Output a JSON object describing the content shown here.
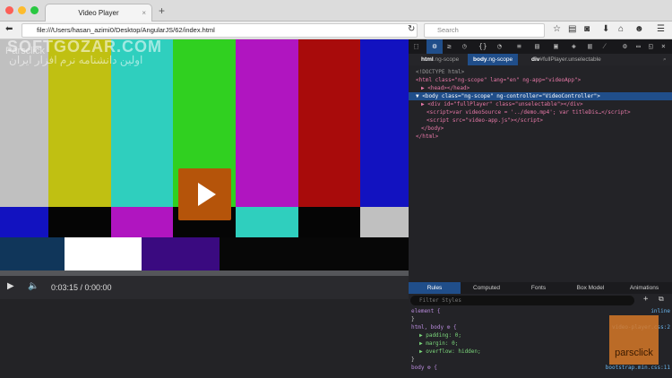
{
  "browser": {
    "tab_title": "Video Player",
    "url": "file:///Users/hasan_azimi0/Desktop/AngularJS/62/index.html",
    "search_placeholder": "Search"
  },
  "watermark": {
    "site": "SOFTGOZAR.COM",
    "brand": "Parsclick",
    "tagline": "اولین دانشنامه نرم افزار ایران",
    "logo": "parsclick"
  },
  "player": {
    "time": "0:03:15 / 0:00:00"
  },
  "devtools": {
    "breadcrumbs": [
      {
        "tag": "html",
        "cls": ".ng-scope"
      },
      {
        "tag": "body",
        "cls": ".ng-scope"
      },
      {
        "tag": "div",
        "cls": "#fullPlayer.unselectable"
      }
    ],
    "markup": {
      "doctype": "<!DOCTYPE html>",
      "html_open": "<html class=\"ng-scope\" lang=\"en\" ng-app=\"videoApp\">",
      "head": "▶ <head></head>",
      "body_open": "▼ <body class=\"ng-scope\" ng-controller=\"VideoController\">",
      "div": "▶ <div id=\"fullPlayer\" class=\"unselectable\"></div>",
      "script1": "<script>var videoSource = '../demo.mp4'; var titleDis…</script>",
      "script2": "<script src=\"video-app.js\"></script>",
      "body_close": "</body>",
      "html_close": "</html>"
    },
    "tabs": [
      "Rules",
      "Computed",
      "Fonts",
      "Box Model",
      "Animations"
    ],
    "filter_placeholder": "Filter Styles",
    "rules": {
      "element": "element {",
      "element_close": "}",
      "element_src": "inline",
      "htmlbody": "html, body ⚙ {",
      "htmlbody_src": "video-player.css:2",
      "padding": "▶ padding: 0;",
      "margin": "▶ margin: 0;",
      "overflow": "▶ overflow: hidden;",
      "close": "}",
      "body": "body ⚙ {",
      "body_src": "bootstrap.min.css:11"
    }
  }
}
